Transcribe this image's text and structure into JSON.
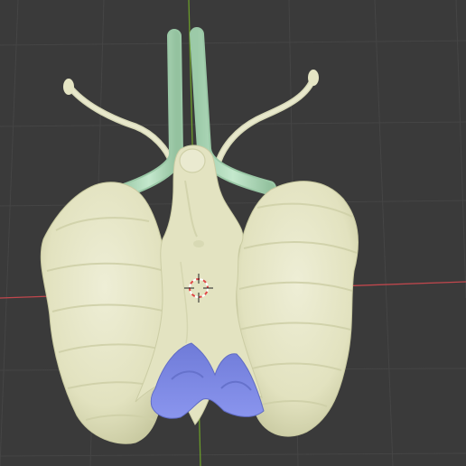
{
  "viewport": {
    "background_color": "#3a3a3a",
    "grid_color": "#454545",
    "x_axis_color": "#c0474d",
    "y_axis_color": "#6a9a2a"
  },
  "scene": {
    "objects": [
      {
        "name": "body-mesh",
        "color": "#e5e5c4",
        "shadow_color": "#cfd0a8"
      },
      {
        "name": "tube-mesh",
        "color": "#b5ddc0"
      },
      {
        "name": "base-mesh",
        "color": "#7f8ae6"
      }
    ]
  },
  "cursor": {
    "icon": "3d-cursor-icon",
    "ring_colors": [
      "#e04848",
      "#ffffff"
    ]
  }
}
